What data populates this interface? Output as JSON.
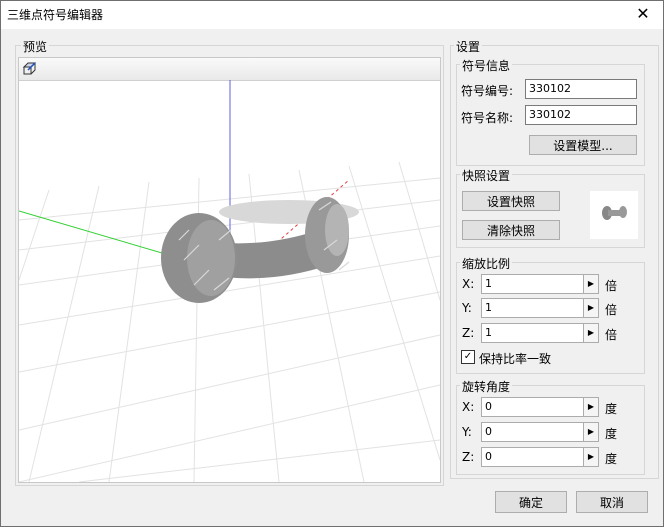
{
  "window": {
    "title": "三维点符号编辑器",
    "close_glyph": "✕"
  },
  "preview": {
    "label": "预览"
  },
  "settings": {
    "label": "设置",
    "symbol_info": {
      "label": "符号信息",
      "code_label": "符号编号:",
      "code_value": "330102",
      "name_label": "符号名称:",
      "name_value": "330102",
      "model_button": "设置模型..."
    },
    "snapshot": {
      "label": "快照设置",
      "set_button": "设置快照",
      "clear_button": "清除快照"
    },
    "scale": {
      "label": "缩放比例",
      "x_label": "X:",
      "x_value": "1",
      "x_unit": "倍",
      "y_label": "Y:",
      "y_value": "1",
      "y_unit": "倍",
      "z_label": "Z:",
      "z_value": "1",
      "z_unit": "倍",
      "keep_ratio_label": "保持比率一致",
      "keep_ratio_checked": true
    },
    "rotation": {
      "label": "旋转角度",
      "x_label": "X:",
      "x_value": "0",
      "x_unit": "度",
      "y_label": "Y:",
      "y_value": "0",
      "y_unit": "度",
      "z_label": "Z:",
      "z_value": "0",
      "z_unit": "度"
    }
  },
  "footer": {
    "ok": "确定",
    "cancel": "取消"
  },
  "icons": {
    "toolbar_view_icon": "box-view-icon",
    "spin_arrow": "▶",
    "check": "✓"
  }
}
